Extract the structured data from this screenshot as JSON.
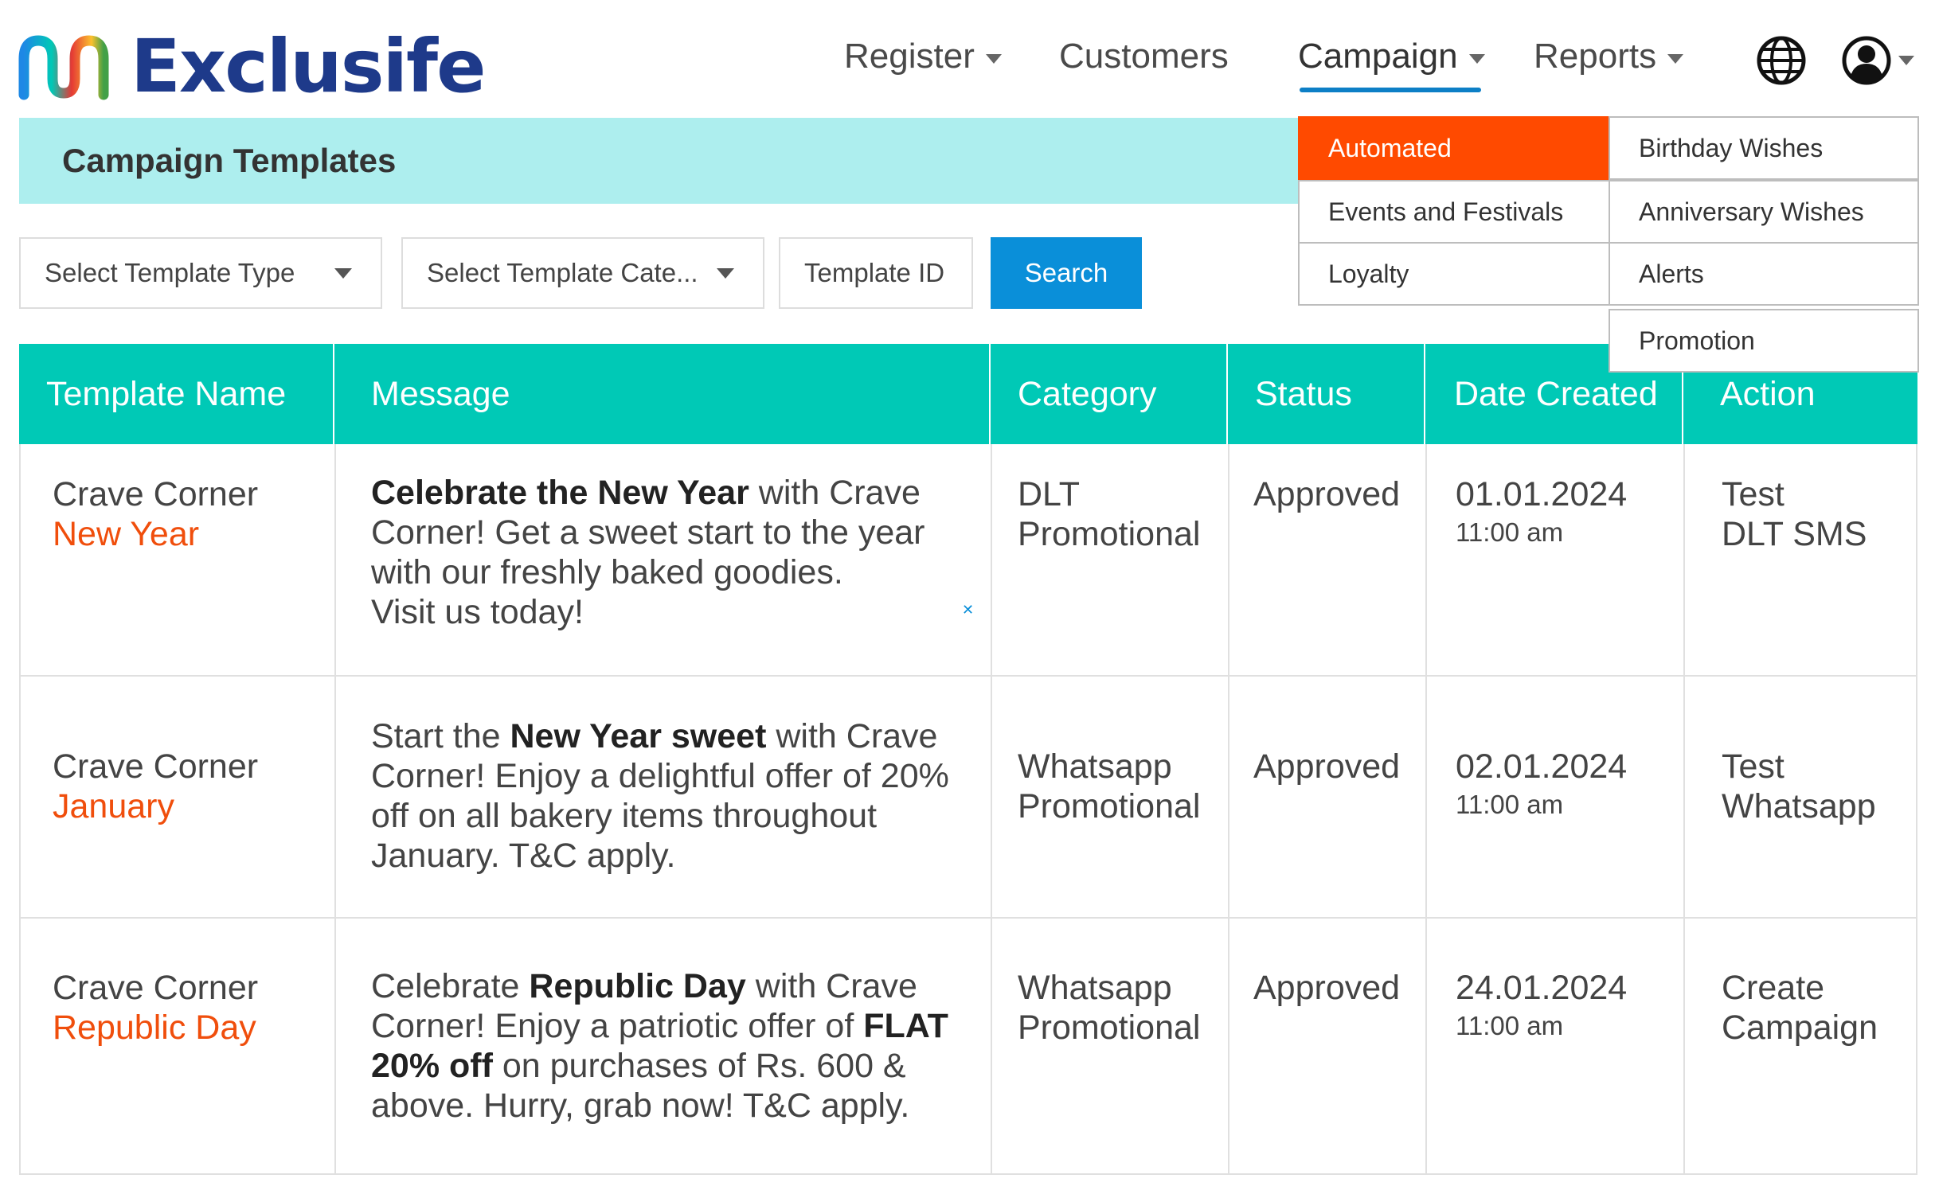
{
  "brand": {
    "name": "Exclusife",
    "colors": [
      "#1e3a8a",
      "#0d7fc6",
      "#00c9b6",
      "#f04e0c"
    ]
  },
  "nav": {
    "register": "Register",
    "customers": "Customers",
    "campaign": "Campaign",
    "reports": "Reports",
    "globe_icon": "globe-icon",
    "user_icon": "user-icon"
  },
  "page_title": "Campaign Templates",
  "filters": {
    "template_type": "Select Template Type",
    "template_category": "Select Template Cate...",
    "template_id": "Template ID",
    "search": "Search"
  },
  "campaign_menu": {
    "left": [
      "Automated",
      "Events and Festivals",
      "Loyalty"
    ],
    "right": [
      "Birthday Wishes",
      "Anniversary Wishes",
      "Alerts",
      "Promotion"
    ],
    "active": "Automated"
  },
  "table": {
    "headers": [
      "Template Name",
      "Message",
      "Category",
      "Status",
      "Date Created",
      "Action"
    ],
    "rows": [
      {
        "name_line1": "Crave Corner",
        "name_line2": "New Year",
        "msg": [
          "Celebrate the New Year",
          " with Crave Corner! Get a sweet start to the year with our freshly baked goodies.",
          "Visit us today!"
        ],
        "category": [
          "DLT",
          "Promotional"
        ],
        "status": "Approved",
        "date": "01.01.2024",
        "time": "11:00 am",
        "action": [
          "Test",
          "DLT SMS"
        ]
      },
      {
        "name_line1": "Crave Corner",
        "name_line2": "January",
        "msg": [
          "Start the ",
          "New Year sweet",
          " with Crave Corner! Enjoy a delightful offer of 20% off on all bakery items throughout January. T&C apply."
        ],
        "category": [
          "Whatsapp",
          "Promotional"
        ],
        "status": "Approved",
        "date": "02.01.2024",
        "time": "11:00 am",
        "action": [
          "Test",
          "Whatsapp"
        ]
      },
      {
        "name_line1": "Crave Corner",
        "name_line2": "Republic Day",
        "msg": [
          "Celebrate ",
          "Republic Day",
          " with Crave Corner! Enjoy a patriotic offer of ",
          "FLAT 20% off",
          " on purchases of Rs. 600 & above. Hurry, grab now! T&C apply."
        ],
        "category": [
          "Whatsapp",
          "Promotional"
        ],
        "status": "Approved",
        "date": "24.01.2024",
        "time": "11:00 am",
        "action": [
          "Create",
          "Campaign"
        ]
      }
    ]
  }
}
